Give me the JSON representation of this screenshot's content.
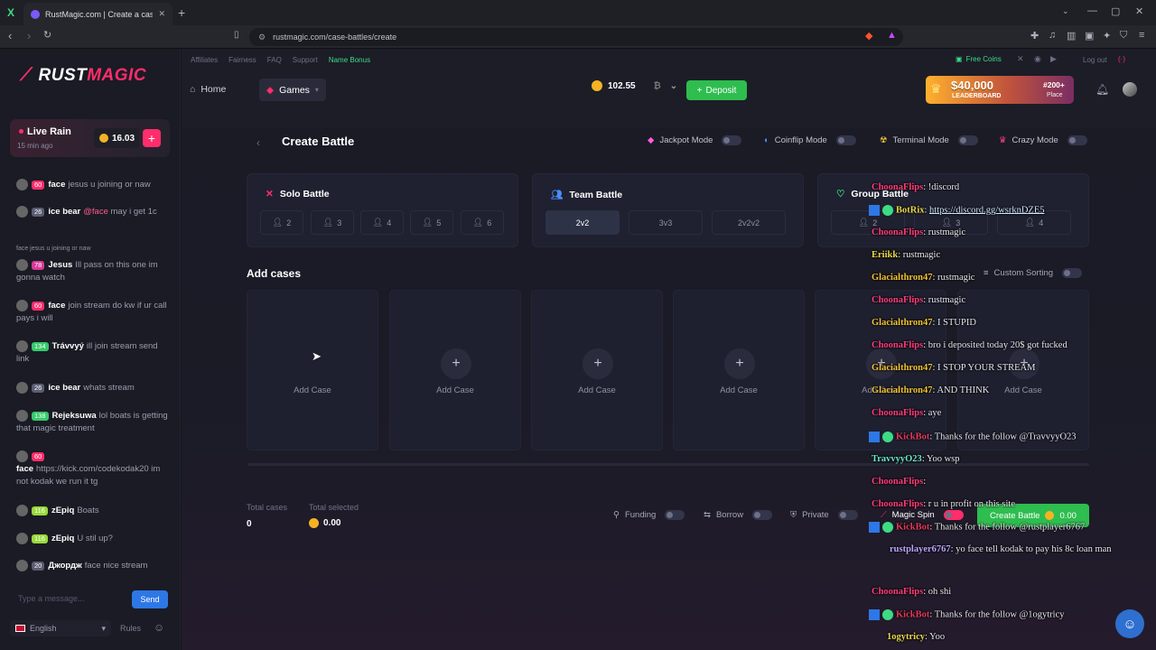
{
  "browser": {
    "tab_title": "RustMagic.com | Create a case b",
    "url": "rustmagic.com/case-battles/create"
  },
  "sidebar": {
    "logo_a": "RUST",
    "logo_b": "MAGIC",
    "rain_title": "Live Rain",
    "rain_time": "15 min ago",
    "rain_amount": "16.03",
    "rain_plus": "+",
    "messages": [
      {
        "level": "60",
        "user": "face",
        "text": "jesus u joining or naw",
        "color": "#ff2d6b"
      },
      {
        "level": "26",
        "user": "ice bear",
        "mention": "@face",
        "text": "may i get 1c",
        "color": "#5a5d72"
      },
      {
        "reply": "face  jesus u joining or naw"
      },
      {
        "level": "78",
        "user": "Jesus",
        "text": "Ill pass on this one im gonna watch",
        "color": "#d63a9a"
      },
      {
        "level": "60",
        "user": "face",
        "text": "join stream do kw if ur call pays i will",
        "color": "#ff2d6b"
      },
      {
        "level": "134",
        "user": "Trávvyý",
        "text": "ill join stream send link",
        "color": "#36c96b"
      },
      {
        "level": "26",
        "user": "ice bear",
        "text": "whats stream",
        "color": "#5a5d72"
      },
      {
        "level": "138",
        "user": "Rejeksuwa",
        "text": "lol boats is getting that magic treatment",
        "color": "#36c96b"
      },
      {
        "level": "60",
        "user": "face",
        "text": "https://kick.com/codekodak20 im not kodak we run it tg",
        "color": "#ff2d6b"
      },
      {
        "level": "116",
        "user": "zEpiq",
        "text": "Boats",
        "color": "#9ad93a"
      },
      {
        "level": "116",
        "user": "zEpiq",
        "text": "U stil up?",
        "color": "#9ad93a"
      },
      {
        "level": "20",
        "user": "Джордж",
        "text": "face nice stream",
        "color": "#5a5d72"
      }
    ],
    "input_placeholder": "Type a message...",
    "send": "Send",
    "language": "English",
    "rules": "Rules"
  },
  "topnav": {
    "links": [
      "Affiliates",
      "Fairness",
      "FAQ",
      "Support",
      "Name Bonus"
    ],
    "free_coins": "Free Coins",
    "logout": "Log out",
    "live": "(·)",
    "home": "Home",
    "games": "Games",
    "balance": "102.55",
    "deposit": "Deposit",
    "leaderboard_amount": "$40,000",
    "leaderboard_label": "LEADERBOARD",
    "place": "#200+",
    "place_label": "Place"
  },
  "battle": {
    "title": "Create Battle",
    "modes": [
      "Jackpot Mode",
      "Coinflip Mode",
      "Terminal Mode",
      "Crazy Mode"
    ],
    "solo": {
      "title": "Solo Battle",
      "options": [
        "2",
        "3",
        "4",
        "5",
        "6"
      ]
    },
    "team": {
      "title": "Team Battle",
      "options": [
        "2v2",
        "3v3",
        "2v2v2"
      ]
    },
    "group": {
      "title": "Group Battle",
      "options": [
        "2",
        "3",
        "4"
      ]
    },
    "add_cases": "Add cases",
    "custom_sorting": "Custom Sorting",
    "case_label": "Add Case",
    "total_cases_label": "Total cases",
    "total_cases": "0",
    "total_selected_label": "Total selected",
    "total_selected": "0.00",
    "funding": "Funding",
    "borrow": "Borrow",
    "private": "Private",
    "magic_spin": "Magic Spin",
    "create": "Create Battle",
    "create_amount": "0.00"
  },
  "overlay_chat": [
    {
      "user": "ChoonaFlips",
      "cls": "pk",
      "text": ": !discord"
    },
    {
      "user": "BotRix",
      "cls": "ye2",
      "link": "https://discord.gg/wsrknDZE5",
      "badges": 2
    },
    {
      "user": "ChoonaFlips",
      "cls": "pk",
      "text": ": rustmagic"
    },
    {
      "user": "Eriikk",
      "cls": "ye2",
      "text": ": rustmagic"
    },
    {
      "user": "Glacialthron47",
      "cls": "yl",
      "text": ": rustmagic"
    },
    {
      "user": "ChoonaFlips",
      "cls": "pk",
      "text": ": rustmagic"
    },
    {
      "user": "Glacialthron47",
      "cls": "yl",
      "text": ": I STUPID"
    },
    {
      "user": "ChoonaFlips",
      "cls": "pk",
      "text": ": bro i deposited today 20$ got fucked"
    },
    {
      "user": "Glacialthron47",
      "cls": "yl",
      "text": ": I STOP YOUR STREAM"
    },
    {
      "user": "Glacialthron47",
      "cls": "yl",
      "text": ": AND THINK"
    },
    {
      "user": "ChoonaFlips",
      "cls": "pk",
      "text": ": aye"
    },
    {
      "user": "KickBot",
      "cls": "rd",
      "text": ": Thanks for the follow @TravvyyO23",
      "badges": 2
    },
    {
      "user": "TravvyyO23",
      "cls": "cy",
      "text": ": Yoo wsp"
    },
    {
      "user": "ChoonaFlips",
      "cls": "pk",
      "text": ":"
    },
    {
      "user": "ChoonaFlips",
      "cls": "pk",
      "text": ": r u in profit on this site"
    },
    {
      "user": "KickBot",
      "cls": "rd",
      "text": ": Thanks for the follow @rustplayer6767",
      "badges": 2
    },
    {
      "user": "rustplayer6767",
      "cls": "lv",
      "text": ": yo face tell kodak to pay his 8c loan man"
    },
    {
      "user": "ChoonaFlips",
      "cls": "pk",
      "text": ": oh shi"
    },
    {
      "user": "KickBot",
      "cls": "rd",
      "text": ": Thanks for the follow @1ogytricy",
      "badges": 2
    },
    {
      "user": "1ogytricy",
      "cls": "ye2",
      "text": ": Yoo"
    }
  ]
}
